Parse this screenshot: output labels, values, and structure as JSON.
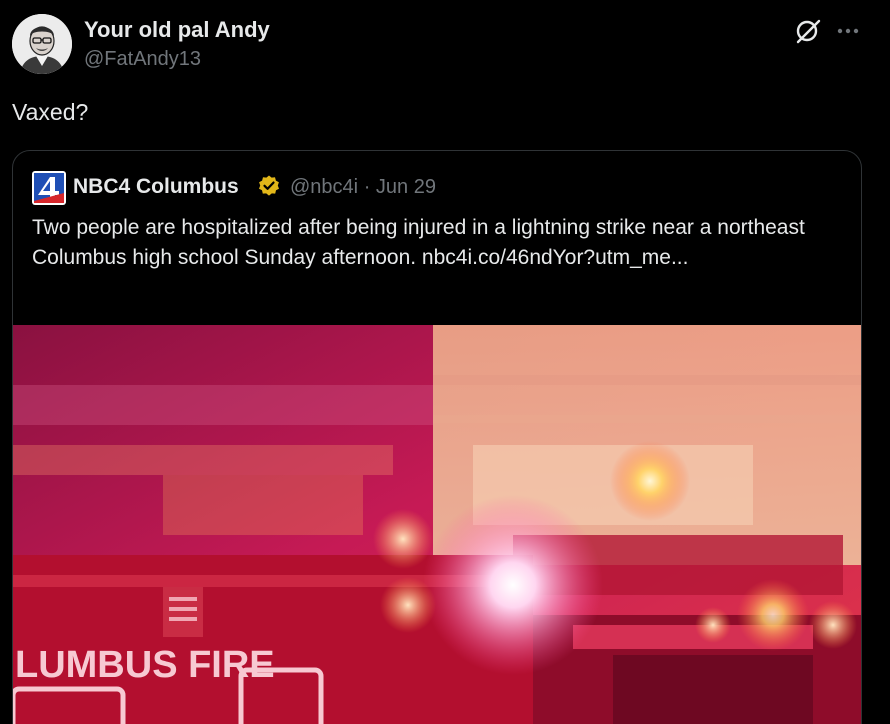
{
  "author": {
    "display_name": "Your old pal Andy",
    "handle": "@FatAndy13"
  },
  "tweet": {
    "text": "Vaxed?"
  },
  "header_icons": {
    "grok": "grok-icon",
    "more": "more-icon"
  },
  "quoted": {
    "display_name": "NBC4 Columbus",
    "verified": true,
    "handle": "@nbc4i",
    "separator": "·",
    "date": "Jun 29",
    "text": "Two people are hospitalized after being injured in a lightning strike near a northeast Columbus high school Sunday afternoon. nbc4i.co/46ndYor?utm_me...",
    "media": {
      "sign_text": "LUMBUS FIRE"
    }
  },
  "colors": {
    "background": "#000000",
    "primary_text": "#e7e9ea",
    "secondary_text": "#71767b",
    "border": "#2f3336",
    "verified_gold": "#e2b719"
  }
}
